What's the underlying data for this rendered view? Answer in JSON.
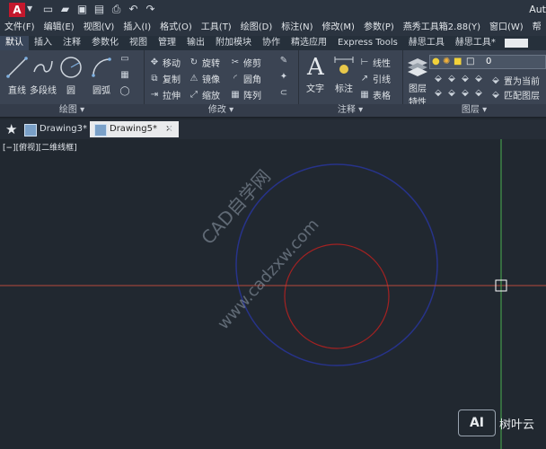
{
  "app": {
    "logo_letter": "A",
    "title_fragment": "Aut"
  },
  "qat": [
    "new-icon",
    "open-icon",
    "save-icon",
    "saveas-icon",
    "print-icon",
    "undo-icon",
    "redo-icon"
  ],
  "menus": [
    "文件(F)",
    "编辑(E)",
    "视图(V)",
    "插入(I)",
    "格式(O)",
    "工具(T)",
    "绘图(D)",
    "标注(N)",
    "修改(M)",
    "参数(P)",
    "燕秀工具箱2.88(Y)",
    "窗口(W)",
    "帮"
  ],
  "ribbon_tabs": [
    "默认",
    "插入",
    "注释",
    "参数化",
    "视图",
    "管理",
    "输出",
    "附加模块",
    "协作",
    "精选应用",
    "Express Tools",
    "赫思工具",
    "赫思工具*"
  ],
  "active_tab": "默认",
  "draw_panel": {
    "title": "绘图",
    "tools": [
      "直线",
      "多段线",
      "圆",
      "圆弧"
    ]
  },
  "modify_panel": {
    "title": "修改",
    "tools": [
      "移动",
      "旋转",
      "修剪",
      "复制",
      "镜像",
      "圆角",
      "拉伸",
      "缩放",
      "阵列"
    ]
  },
  "annot_panel": {
    "title": "注释",
    "tools": [
      "文字",
      "标注",
      "线性",
      "引线",
      "表格"
    ]
  },
  "layer_panel": {
    "title": "图层",
    "props_label_1": "图层",
    "props_label_2": "特性",
    "current_layer": "0",
    "set_current": "置为当前",
    "match_layer": "匹配图层"
  },
  "doc_tabs": [
    "Drawing3*",
    "Drawing5*"
  ],
  "active_doc": "Drawing5*",
  "viewport_label": "[−][俯视][二维线框]",
  "watermark": [
    "CAD自学网",
    "www.cadzxw.com"
  ],
  "badge": {
    "logo": "AI",
    "text": "树叶云"
  },
  "colors": {
    "accent_red": "#c4182d",
    "axis_green": "#4caf50",
    "axis_red": "#b64a3c",
    "circle_blue": "#27338a",
    "circle_red": "#a32222"
  }
}
